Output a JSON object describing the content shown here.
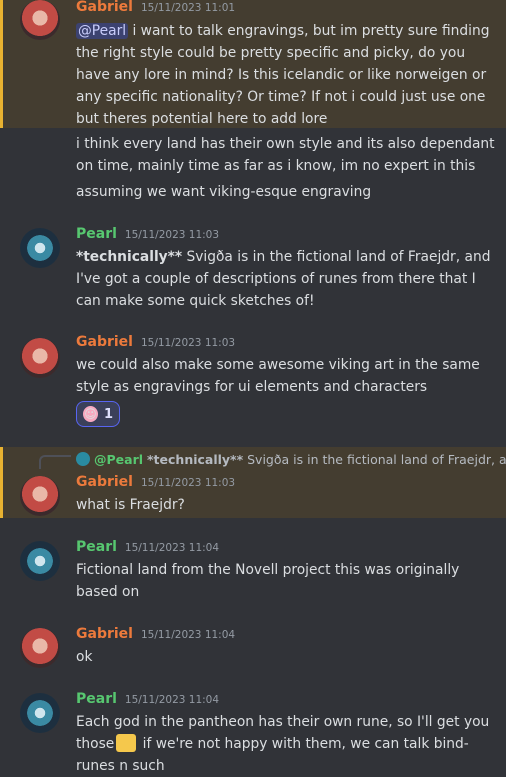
{
  "messages": [
    {
      "author": "Gabriel",
      "time": "15/11/2023 11:01",
      "mention": "@Pearl",
      "text": " i want to talk engravings, but im pretty sure finding the right style could be pretty specific and picky, do you have any lore in mind? Is this icelandic or like norweigen or any specific nationality? Or time? If not i could just use one but theres potential here to add lore"
    },
    {
      "text1": "i think every land has their own style and its also dependant on time, mainly time as far as i know, im no expert in this",
      "text2": "assuming we want viking-esque engraving"
    },
    {
      "author": "Pearl",
      "time": "15/11/2023 11:03",
      "bold": "*technically**",
      "text": " Svigða is in the fictional land of Fraejdr, and I've got a couple of descriptions of runes from there that I can make some quick sketches of!"
    },
    {
      "author": "Gabriel",
      "time": "15/11/2023 11:03",
      "text": "we could also make some awesome viking art in the same style as engravings for ui elements and characters",
      "reaction_count": "1",
      "reaction_icon": "blushing-face-icon"
    },
    {
      "reply_author": "@Pearl",
      "reply_bold": "*technically**",
      "reply_text": " Svigða is in the fictional land of Fraejdr, and",
      "author": "Gabriel",
      "time": "15/11/2023 11:03",
      "text": "what is Fraejdr?"
    },
    {
      "author": "Pearl",
      "time": "15/11/2023 11:04",
      "text": "Fictional land from the Novell project this was originally based on"
    },
    {
      "author": "Gabriel",
      "time": "15/11/2023 11:04",
      "text": "ok"
    },
    {
      "author": "Pearl",
      "time": "15/11/2023 11:04",
      "text_a": "Each god in the pantheon has their own rune, so I'll get you those",
      "text_b": " if we're not happy with them, we can talk bind-runes n such",
      "emoji": "thumbs-up-icon"
    }
  ]
}
